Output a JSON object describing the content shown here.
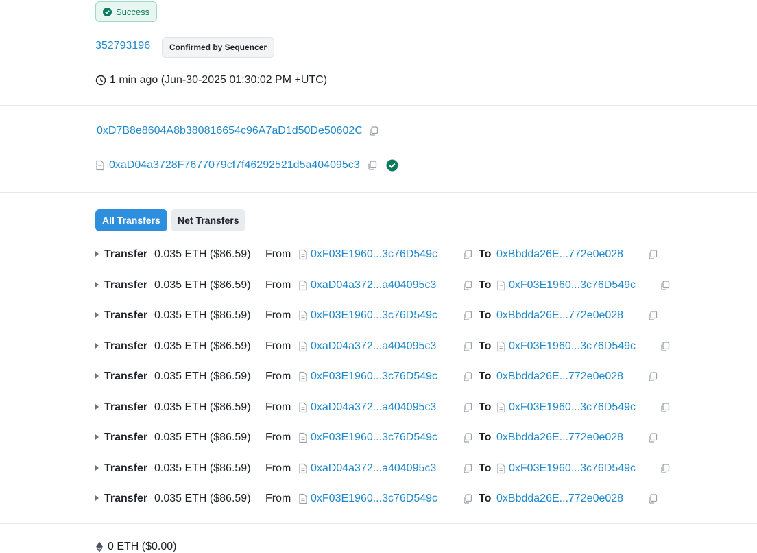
{
  "status": {
    "label": "Success"
  },
  "block": {
    "number": "352793196",
    "confirmation": "Confirmed by Sequencer"
  },
  "timestamp": {
    "text": "1 min ago (Jun-30-2025 01:30:02 PM +UTC)"
  },
  "from_address": "0xD7B8e8604A8b380816654c96A7aD1d50De50602C",
  "interacted_with": "0xaD04a3728F7677079cf7f46292521d5a404095c3",
  "tabs": [
    {
      "label": "All Transfers",
      "active": true
    },
    {
      "label": "Net Transfers",
      "active": false
    }
  ],
  "transfers": [
    {
      "label": "Transfer",
      "amount": "0.035 ETH ($86.59)",
      "from_label": "From",
      "from": "0xF03E1960...3c76D549c",
      "to_label": "To",
      "to": "0xBbdda26E...772e0e028",
      "to_contract": false
    },
    {
      "label": "Transfer",
      "amount": "0.035 ETH ($86.59)",
      "from_label": "From",
      "from": "0xaD04a372...a404095c3",
      "to_label": "To",
      "to": "0xF03E1960...3c76D549c",
      "to_contract": true
    },
    {
      "label": "Transfer",
      "amount": "0.035 ETH ($86.59)",
      "from_label": "From",
      "from": "0xF03E1960...3c76D549c",
      "to_label": "To",
      "to": "0xBbdda26E...772e0e028",
      "to_contract": false
    },
    {
      "label": "Transfer",
      "amount": "0.035 ETH ($86.59)",
      "from_label": "From",
      "from": "0xaD04a372...a404095c3",
      "to_label": "To",
      "to": "0xF03E1960...3c76D549c",
      "to_contract": true
    },
    {
      "label": "Transfer",
      "amount": "0.035 ETH ($86.59)",
      "from_label": "From",
      "from": "0xF03E1960...3c76D549c",
      "to_label": "To",
      "to": "0xBbdda26E...772e0e028",
      "to_contract": false
    },
    {
      "label": "Transfer",
      "amount": "0.035 ETH ($86.59)",
      "from_label": "From",
      "from": "0xaD04a372...a404095c3",
      "to_label": "To",
      "to": "0xF03E1960...3c76D549c",
      "to_contract": true
    },
    {
      "label": "Transfer",
      "amount": "0.035 ETH ($86.59)",
      "from_label": "From",
      "from": "0xF03E1960...3c76D549c",
      "to_label": "To",
      "to": "0xBbdda26E...772e0e028",
      "to_contract": false
    },
    {
      "label": "Transfer",
      "amount": "0.035 ETH ($86.59)",
      "from_label": "From",
      "from": "0xaD04a372...a404095c3",
      "to_label": "To",
      "to": "0xF03E1960...3c76D549c",
      "to_contract": true
    },
    {
      "label": "Transfer",
      "amount": "0.035 ETH ($86.59)",
      "from_label": "From",
      "from": "0xF03E1960...3c76D549c",
      "to_label": "To",
      "to": "0xBbdda26E...772e0e028",
      "to_contract": false
    }
  ],
  "value": {
    "text": "0 ETH ($0.00)"
  },
  "icons": {
    "status": "check-circle-icon",
    "time": "clock-icon",
    "copy": "copy-icon",
    "contract": "document-icon",
    "verified": "verified-check-icon",
    "expand": "caret-right-icon",
    "eth": "ethereum-icon"
  },
  "colors": {
    "link": "#1e88c9",
    "success": "#0b7a5b",
    "tab_active": "#2f8fdf"
  }
}
